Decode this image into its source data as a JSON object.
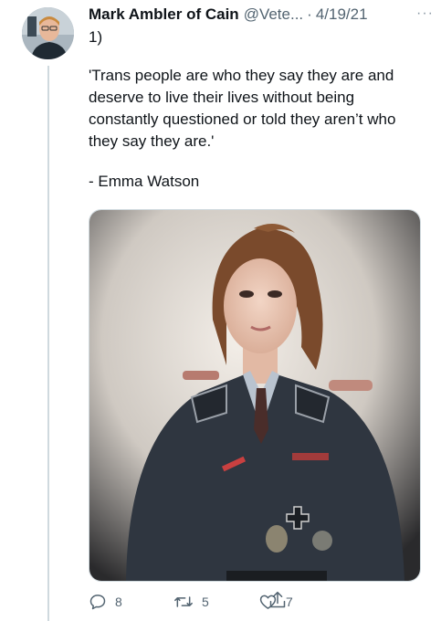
{
  "tweet": {
    "author_name": "Mark Ambler of Cain",
    "handle": "@Vete...",
    "separator": "·",
    "date": "4/19/21",
    "more_label": "···",
    "paragraphs": {
      "number": "1)",
      "quote": "'Trans people are who they say they are and deserve to live their lives without being constantly questioned or told they aren’t who they say they are.'",
      "attribution": "- Emma Watson"
    }
  },
  "actions": {
    "reply_count": "8",
    "retweet_count": "5",
    "like_count": "7"
  },
  "icons": {
    "reply": "reply-icon",
    "retweet": "retweet-icon",
    "like": "like-icon",
    "share": "share-icon",
    "more": "more-icon"
  },
  "colors": {
    "text_primary": "#0f1419",
    "text_secondary": "#536471",
    "thread_line": "#cfd9de"
  }
}
